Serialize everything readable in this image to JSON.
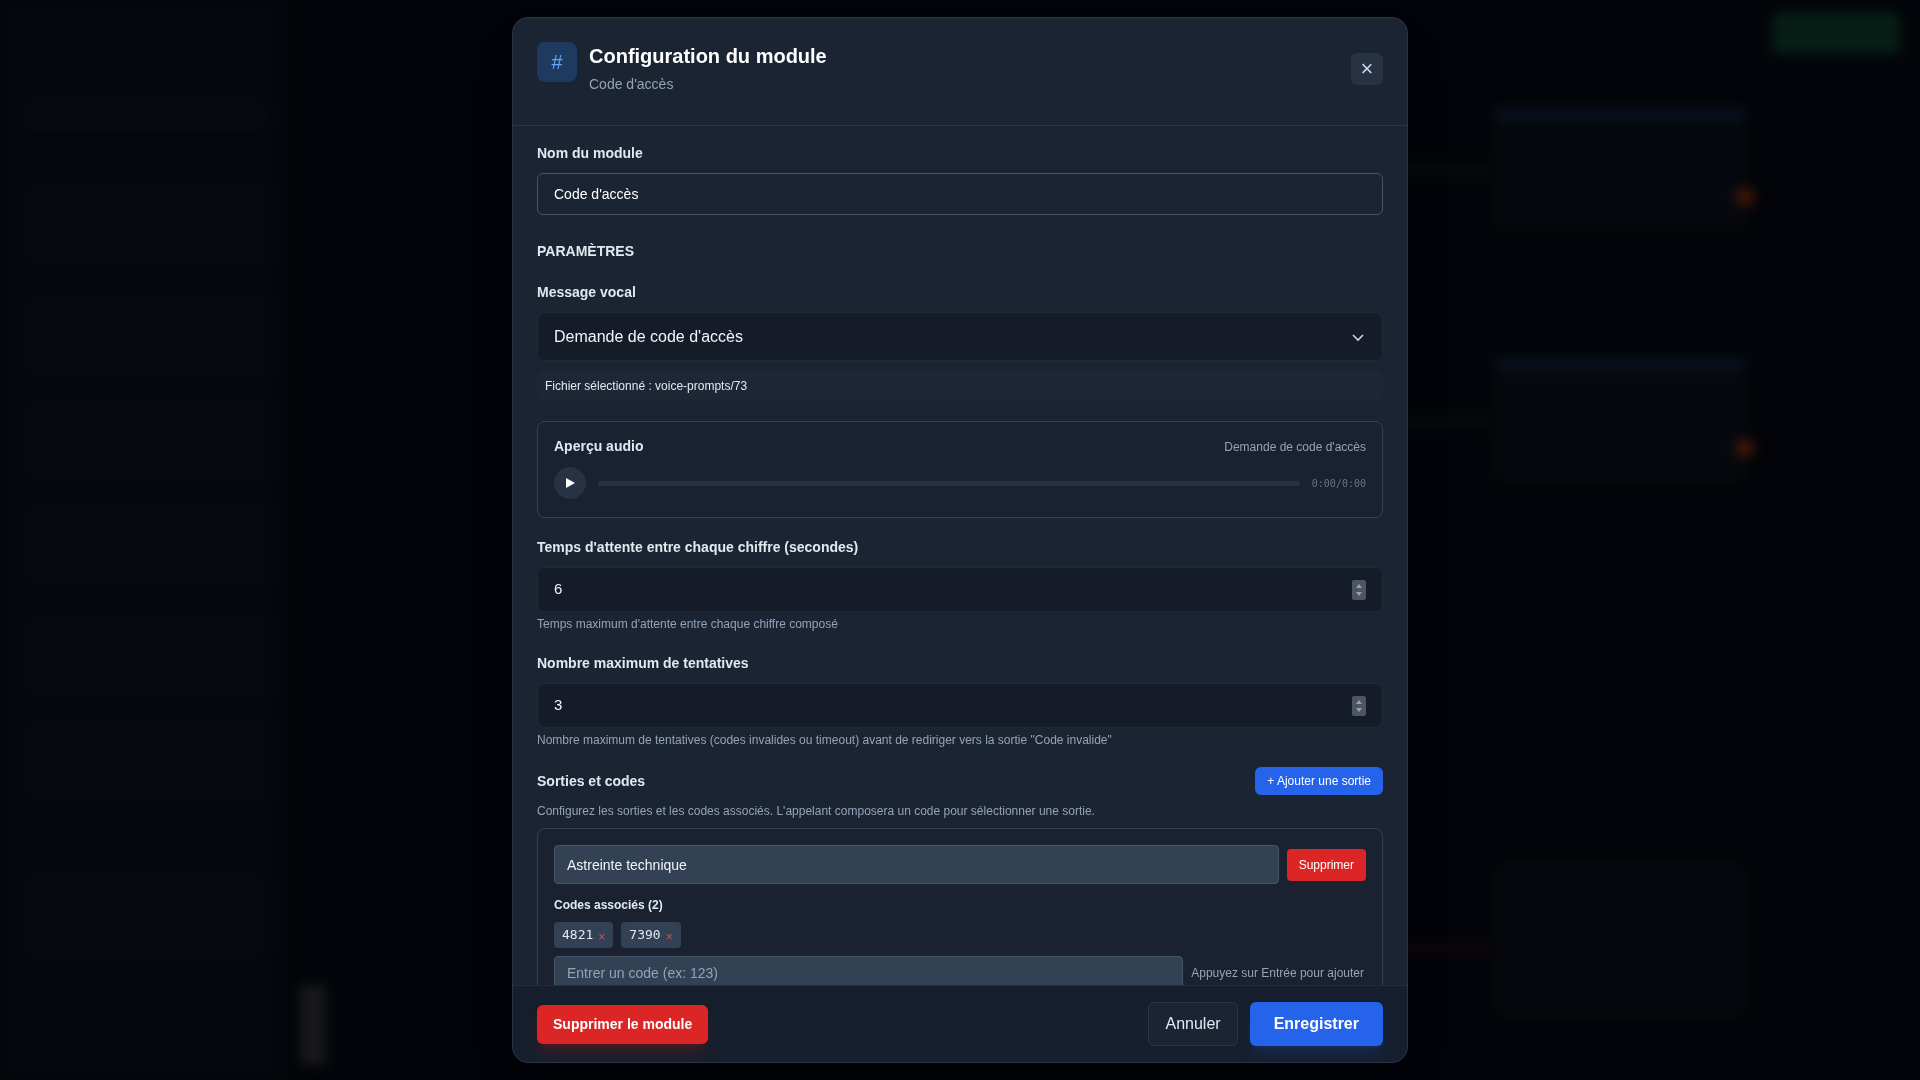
{
  "dialog": {
    "icon": "#",
    "title": "Configuration du module",
    "subtitle": "Code d'accès",
    "close": "×"
  },
  "name_field": {
    "label": "Nom du module",
    "value": "Code d'accès"
  },
  "section_title": "PARAMÈTRES",
  "voice_message": {
    "label": "Message vocal",
    "value": "Demande de code d'accès",
    "selected_file": "Fichier sélectionné : voice-prompts/73"
  },
  "audio_preview": {
    "title": "Aperçu audio",
    "track": "Demande de code d'accès",
    "time": "0:00/0:00"
  },
  "number_fields": [
    {
      "label": "Temps d'attente entre chaque chiffre (secondes)",
      "value": "6",
      "help": "Temps maximum d'attente entre chaque chiffre composé"
    },
    {
      "label": "Nombre maximum de tentatives",
      "value": "3",
      "help": "Nombre maximum de tentatives (codes invalides ou timeout) avant de rediriger vers la sortie \"Code invalide\""
    }
  ],
  "outputs": {
    "title": "Sorties et codes",
    "add_button": "+ Ajouter une sortie",
    "description": "Configurez les sorties et les codes associés. L'appelant composera un code pour sélectionner une sortie.",
    "items": [
      {
        "name": "Astreinte technique",
        "delete_button": "Supprimer",
        "codes_label": "Codes associés (2)",
        "codes": [
          {
            "code": "4821",
            "remove": "×"
          },
          {
            "code": "7390",
            "remove": "×"
          }
        ],
        "code_placeholder": "Entrer un code (ex: 123)",
        "hint": "Appuyez sur Entrée pour ajouter"
      }
    ]
  },
  "footer": {
    "delete_module": "Supprimer le module",
    "cancel": "Annuler",
    "save": "Enregistrer"
  }
}
